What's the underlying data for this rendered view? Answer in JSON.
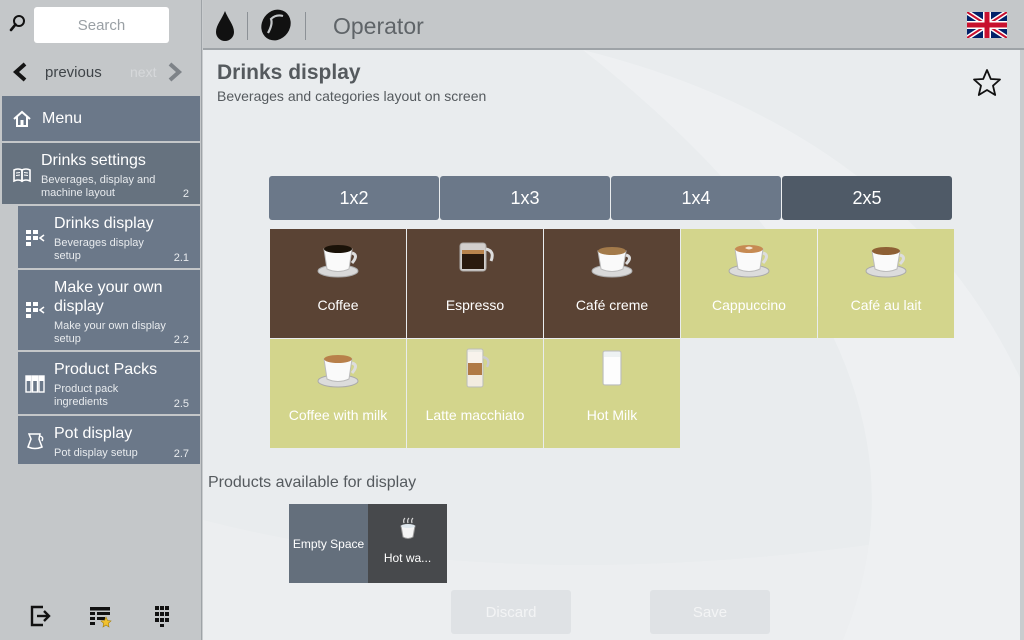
{
  "search": {
    "placeholder": "Search"
  },
  "nav": {
    "previous": "previous",
    "next": "next"
  },
  "menu": {
    "label": "Menu"
  },
  "sidebar": {
    "parent": {
      "title": "Drinks settings",
      "subtitle": "Beverages, display and machine layout",
      "number": "2"
    },
    "items": [
      {
        "title": "Drinks display",
        "subtitle": "Beverages display setup",
        "number": "2.1"
      },
      {
        "title": "Make your own display",
        "subtitle": "Make your own display setup",
        "number": "2.2"
      },
      {
        "title": "Product Packs",
        "subtitle": "Product pack ingredients",
        "number": "2.5"
      },
      {
        "title": "Pot display",
        "subtitle": "Pot display setup",
        "number": "2.7"
      }
    ]
  },
  "header": {
    "title": "Operator"
  },
  "page": {
    "title": "Drinks display",
    "subtitle": "Beverages and categories layout on screen"
  },
  "layouts": [
    {
      "label": "1x2",
      "active": false
    },
    {
      "label": "1x3",
      "active": false
    },
    {
      "label": "1x4",
      "active": false
    },
    {
      "label": "2x5",
      "active": true
    }
  ],
  "drinks": [
    {
      "label": "Coffee",
      "style": "dark",
      "icon": "cup-black-coffee-icon"
    },
    {
      "label": "Espresso",
      "style": "dark",
      "icon": "glass-espresso-icon"
    },
    {
      "label": "Café creme",
      "style": "dark",
      "icon": "cup-cafe-creme-icon"
    },
    {
      "label": "Cappuccino",
      "style": "light",
      "icon": "cup-cappuccino-icon"
    },
    {
      "label": "Café au lait",
      "style": "light",
      "icon": "cup-cafe-au-lait-icon"
    },
    {
      "label": "Coffee with milk",
      "style": "light",
      "icon": "cup-coffee-with-milk-icon"
    },
    {
      "label": "Latte macchiato",
      "style": "light",
      "icon": "glass-latte-macchiato-icon"
    },
    {
      "label": "Hot Milk",
      "style": "light",
      "icon": "glass-hot-milk-icon"
    }
  ],
  "available": {
    "label": "Products available for display",
    "items": [
      {
        "label": "Empty Space"
      },
      {
        "label": "Hot wa..."
      }
    ]
  },
  "actions": {
    "discard": "Discard",
    "save": "Save"
  },
  "colors": {
    "sidebar_item": "#6b7889",
    "tab_active": "#4f5a67",
    "drink_dark": "#5a4334",
    "drink_light": "#d3d58c"
  }
}
